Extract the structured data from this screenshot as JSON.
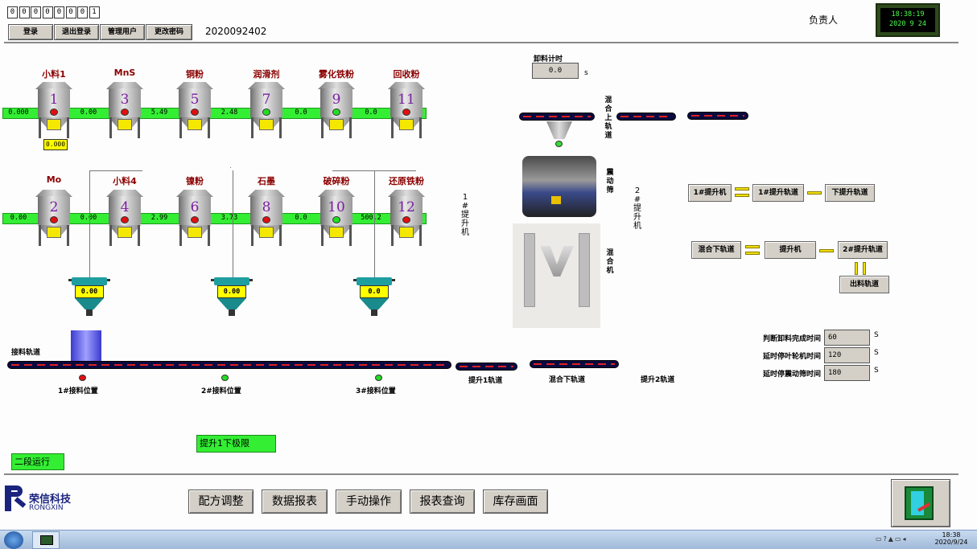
{
  "top": {
    "digits": [
      "0",
      "0",
      "0",
      "0",
      "0",
      "0",
      "0",
      "1"
    ],
    "buttons": [
      "登录",
      "退出登录",
      "管理用户",
      "更改密码"
    ],
    "batch_id": "2020092402",
    "responsible_label": "负责人",
    "clock": {
      "time": "18:38:19",
      "date": "2020  9   24"
    }
  },
  "silos_row1": [
    {
      "label": "小料1",
      "num": "1",
      "value": "0.000",
      "dot": "red"
    },
    {
      "label": "MnS",
      "num": "3",
      "value": "0.00",
      "dot": "red"
    },
    {
      "label": "铜粉",
      "num": "5",
      "value": "5.49",
      "dot": "red"
    },
    {
      "label": "润滑剂",
      "num": "7",
      "value": "2.48",
      "dot": "green"
    },
    {
      "label": "雾化铁粉",
      "num": "9",
      "value": "0.0",
      "dot": "green"
    },
    {
      "label": "回收粉",
      "num": "11",
      "value": "0.0",
      "dot": "red"
    }
  ],
  "silos_row2": [
    {
      "label": "Mo",
      "num": "2",
      "value": "0.00",
      "dot": "red"
    },
    {
      "label": "小料4",
      "num": "4",
      "value": "0.00",
      "dot": "red"
    },
    {
      "label": "镍粉",
      "num": "6",
      "value": "2.99",
      "dot": "red"
    },
    {
      "label": "石墨",
      "num": "8",
      "value": "3.73",
      "dot": "red"
    },
    {
      "label": "破碎粉",
      "num": "10",
      "value": "0.0",
      "dot": "green"
    },
    {
      "label": "还原铁粉",
      "num": "12",
      "value": "500.2",
      "dot": "red"
    }
  ],
  "small_scale_value": "0.000",
  "hoppers": [
    "0.00",
    "0.00",
    "0.0"
  ],
  "unload_timer": {
    "label": "卸料计时",
    "value": "0.0",
    "unit": "s"
  },
  "tracks": {
    "receive": "接料轨道",
    "lift1": "提升1轨道",
    "mix_down": "混合下轨道",
    "lift2": "提升2轨道",
    "mix_up": "混合上轨道"
  },
  "positions": [
    {
      "label": "1#接料位置",
      "dot": "red"
    },
    {
      "label": "2#接料位置",
      "dot": "green"
    },
    {
      "label": "3#接料位置",
      "dot": "green"
    }
  ],
  "lift1_label": "1#提升机",
  "lift2_label": "2#提升机",
  "screen_label": "震动筛",
  "mixer_label": "混合机",
  "flow": {
    "a": "1#提升机",
    "b": "1#提升轨道",
    "c": "下提升轨道",
    "d": "混合下轨道",
    "e": "提升机",
    "f": "2#提升轨道",
    "g": "出料轨道"
  },
  "timers": [
    {
      "label": "判断卸料完成时间",
      "value": "60",
      "unit": "S"
    },
    {
      "label": "延时停叶轮机时间",
      "value": "120",
      "unit": "S"
    },
    {
      "label": "延时停震动筛时间",
      "value": "180",
      "unit": "S"
    }
  ],
  "status": {
    "limit": "提升1下极限",
    "stage": "二段运行"
  },
  "logo": {
    "cn": "荣信科技",
    "en": "RONGXIN"
  },
  "nav": [
    "配方调整",
    "数据报表",
    "手动操作",
    "报表查询",
    "库存画面"
  ],
  "taskbar": {
    "time": "18:38",
    "date": "2020/9/24"
  },
  "colors": {
    "green_bar": "#33ee33",
    "hopper": "#1f9ea0",
    "track": "#0a0a40"
  }
}
